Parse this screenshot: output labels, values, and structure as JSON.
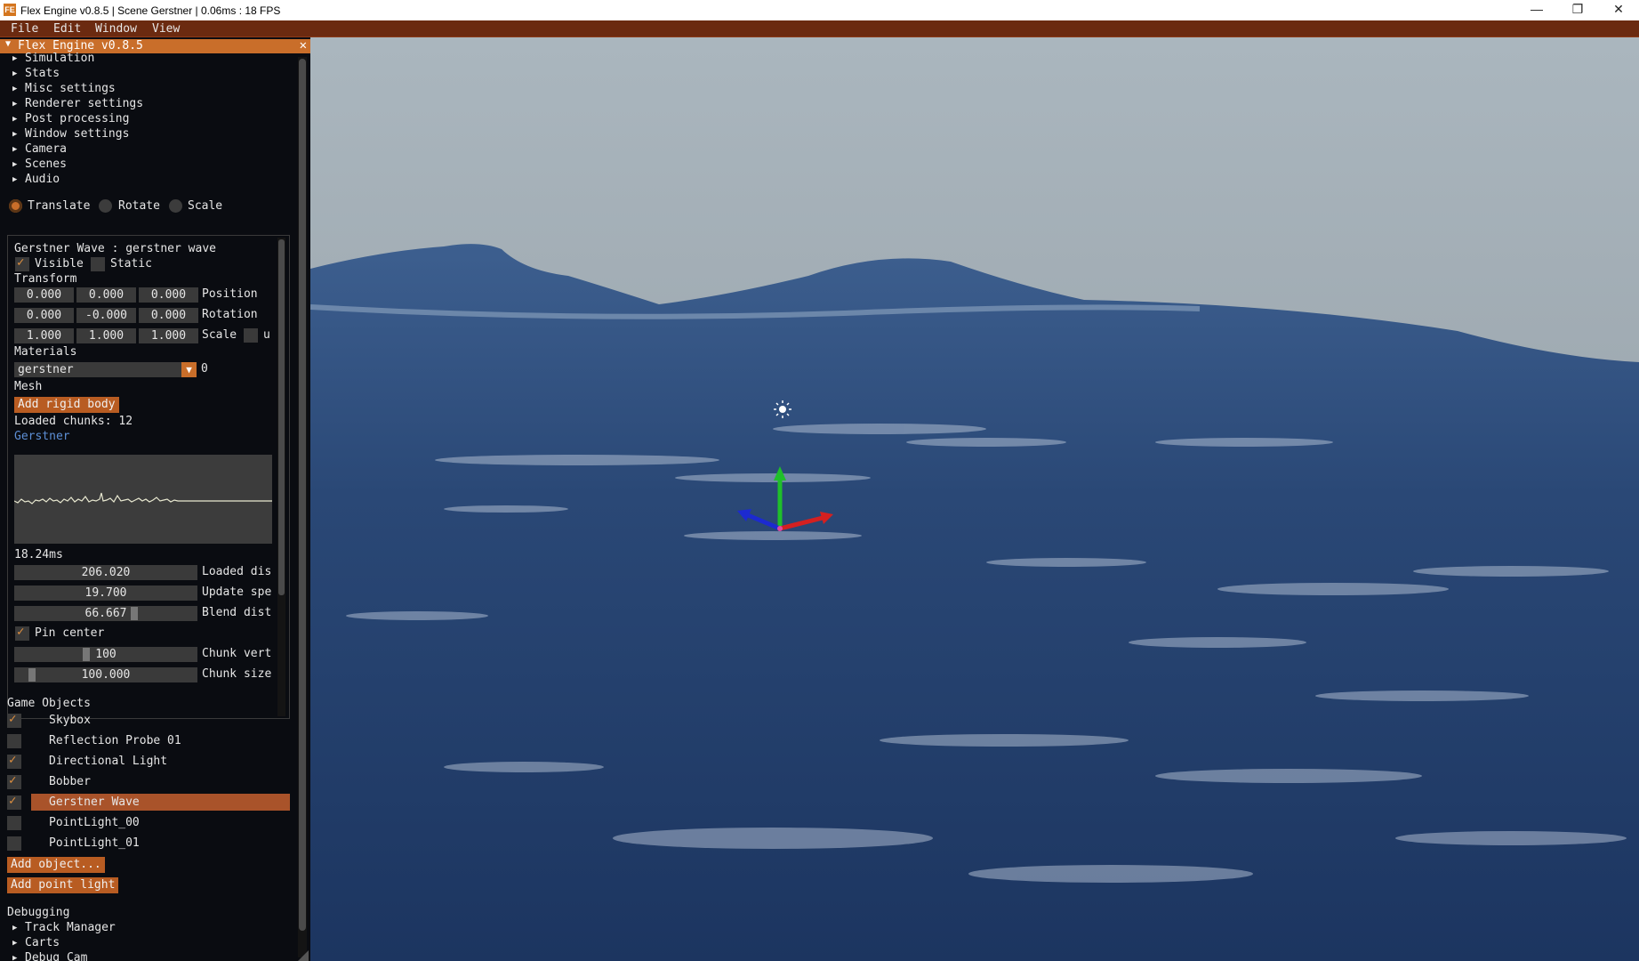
{
  "window": {
    "app_icon_text": "FE",
    "title": "Flex Engine v0.8.5 | Scene Gerstner | 0.06ms : 18 FPS",
    "minimize": "—",
    "maximize": "❐",
    "close": "✕"
  },
  "menubar": {
    "items": [
      "File",
      "Edit",
      "Window",
      "View"
    ]
  },
  "panel": {
    "title": "Flex Engine v0.8.5",
    "close": "✕",
    "collapse": "▼",
    "sections": [
      "Simulation",
      "Stats",
      "Misc settings",
      "Renderer settings",
      "Post processing",
      "Window settings",
      "Camera",
      "Scenes",
      "Audio"
    ],
    "transform_modes": [
      {
        "label": "Translate",
        "selected": true
      },
      {
        "label": "Rotate",
        "selected": false
      },
      {
        "label": "Scale",
        "selected": false
      }
    ]
  },
  "inspector": {
    "header": "Gerstner Wave : gerstner wave",
    "visible_label": "Visible",
    "visible": true,
    "static_label": "Static",
    "static": false,
    "transform_label": "Transform",
    "position": [
      "0.000",
      "0.000",
      "0.000"
    ],
    "position_label": "Position",
    "rotation": [
      "0.000",
      "-0.000",
      "0.000"
    ],
    "rotation_label": "Rotation",
    "scale": [
      "1.000",
      "1.000",
      "1.000"
    ],
    "scale_label": "Scale",
    "scale_uniform_label": "u",
    "materials_label": "Materials",
    "material": "gerstner",
    "material_index": "0",
    "mesh_label": "Mesh",
    "add_rigid_body": "Add rigid body",
    "loaded_chunks": "Loaded chunks: 12",
    "graph_title": "Gerstner",
    "graph_time": "18.24ms",
    "loaded_dist_value": "206.020",
    "loaded_dist_label": "Loaded dis",
    "update_speed_value": "19.700",
    "update_speed_label": "Update spe",
    "blend_dist_value": "66.667",
    "blend_dist_label": "Blend dist",
    "blend_dist_fraction": 0.66,
    "pin_center_label": "Pin center",
    "pin_center": true,
    "chunk_vert_value": "100",
    "chunk_vert_label": "Chunk vert",
    "chunk_vert_fraction": 0.39,
    "chunk_size_value": "100.000",
    "chunk_size_label": "Chunk size",
    "chunk_size_fraction": 0.08
  },
  "game_objects": {
    "label": "Game Objects",
    "items": [
      {
        "name": "Skybox",
        "checked": true,
        "selected": false
      },
      {
        "name": "Reflection Probe 01",
        "checked": false,
        "selected": false
      },
      {
        "name": "Directional Light",
        "checked": true,
        "selected": false
      },
      {
        "name": "Bobber",
        "checked": true,
        "selected": false
      },
      {
        "name": "Gerstner Wave",
        "checked": true,
        "selected": true
      },
      {
        "name": "PointLight_00",
        "checked": false,
        "selected": false
      },
      {
        "name": "PointLight_01",
        "checked": false,
        "selected": false
      }
    ],
    "add_object": "Add object...",
    "add_point_light": "Add point light"
  },
  "debugging": {
    "label": "Debugging",
    "items": [
      "Track Manager",
      "Carts",
      "Debug Cam"
    ]
  },
  "colors": {
    "accent": "#c96e2a",
    "menubar": "#6b2a10",
    "ocean_deep": "#1e3a66",
    "sky": "#a9b5bd"
  },
  "gizmo": {
    "icon": "translate-gizmo-icon",
    "light_icon": "sun-icon"
  }
}
